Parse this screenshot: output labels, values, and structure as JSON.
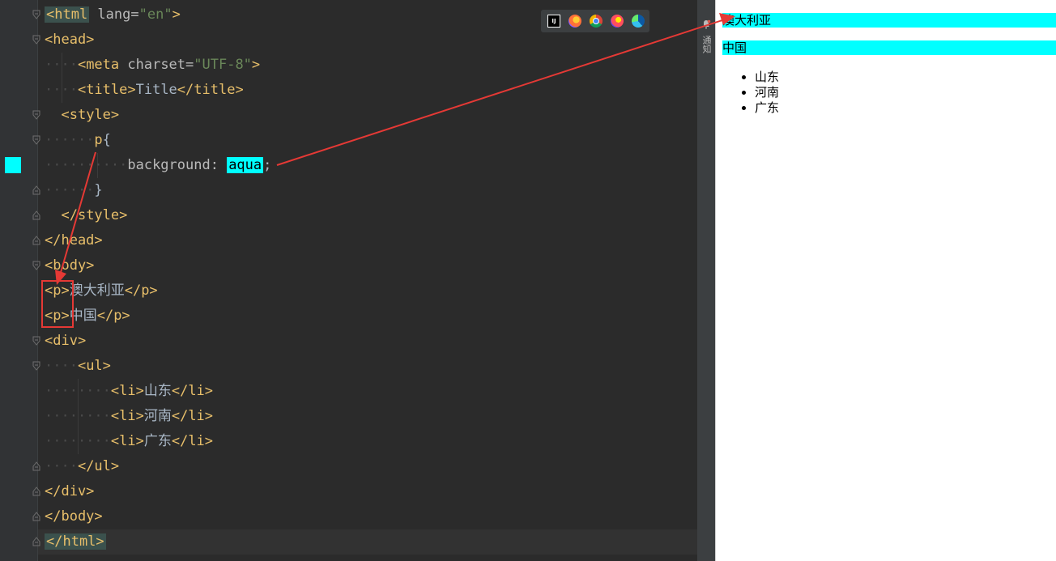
{
  "editor": {
    "lines": {
      "l1": {
        "open": "<html",
        "attr": " lang=",
        "val": "\"en\"",
        "close": ">"
      },
      "l2": {
        "text": "<head>"
      },
      "l3": {
        "ws": "····",
        "open": "<meta",
        "attr": " charset=",
        "val": "\"UTF-8\"",
        "close": ">"
      },
      "l4": {
        "ws": "····",
        "open": "<title>",
        "inner": "Title",
        "close": "</title>"
      },
      "l5": {
        "ws": "  ",
        "text": "<style>"
      },
      "l6": {
        "ws": "······",
        "sel": "p",
        "brace": "{"
      },
      "l7": {
        "ws": "··········",
        "prop": "background: ",
        "value": "aqua",
        "semi": ";"
      },
      "l8": {
        "ws": "······",
        "brace": "}"
      },
      "l9": {
        "ws": "  ",
        "text": "</style>"
      },
      "l10": {
        "text": "</head>"
      },
      "l11": {
        "text": "<body>"
      },
      "l12": {
        "open": "<p>",
        "inner": "澳大利亚",
        "close": "</p>"
      },
      "l13": {
        "open": "<p>",
        "inner": "中国",
        "close": "</p>"
      },
      "l14": {
        "text": "<div>"
      },
      "l15": {
        "ws": "····",
        "text": "<ul>"
      },
      "l16": {
        "ws": "········",
        "open": "<li>",
        "inner": "山东",
        "close": "</li>"
      },
      "l17": {
        "ws": "········",
        "open": "<li>",
        "inner": "河南",
        "close": "</li>"
      },
      "l18": {
        "ws": "········",
        "open": "<li>",
        "inner": "广东",
        "close": "</li>"
      },
      "l19": {
        "ws": "····",
        "text": "</ul>"
      },
      "l20": {
        "text": "</div>"
      },
      "l21": {
        "text": "</body>"
      },
      "l22": {
        "text": "</html>"
      }
    }
  },
  "toolbar": {
    "ij_label": "IJ",
    "browsers": [
      "intellij-icon",
      "firefox-icon",
      "chrome-icon",
      "firefox-dev-icon",
      "edge-icon"
    ]
  },
  "sidestrip": {
    "label": "通知"
  },
  "preview": {
    "p1": "澳大利亚",
    "p2": "中国",
    "list": [
      "山东",
      "河南",
      "广东"
    ]
  },
  "colors": {
    "aqua": "#00ffff",
    "annotation": "#e53935",
    "tag": "#e8bf6a",
    "string": "#6a8759"
  }
}
